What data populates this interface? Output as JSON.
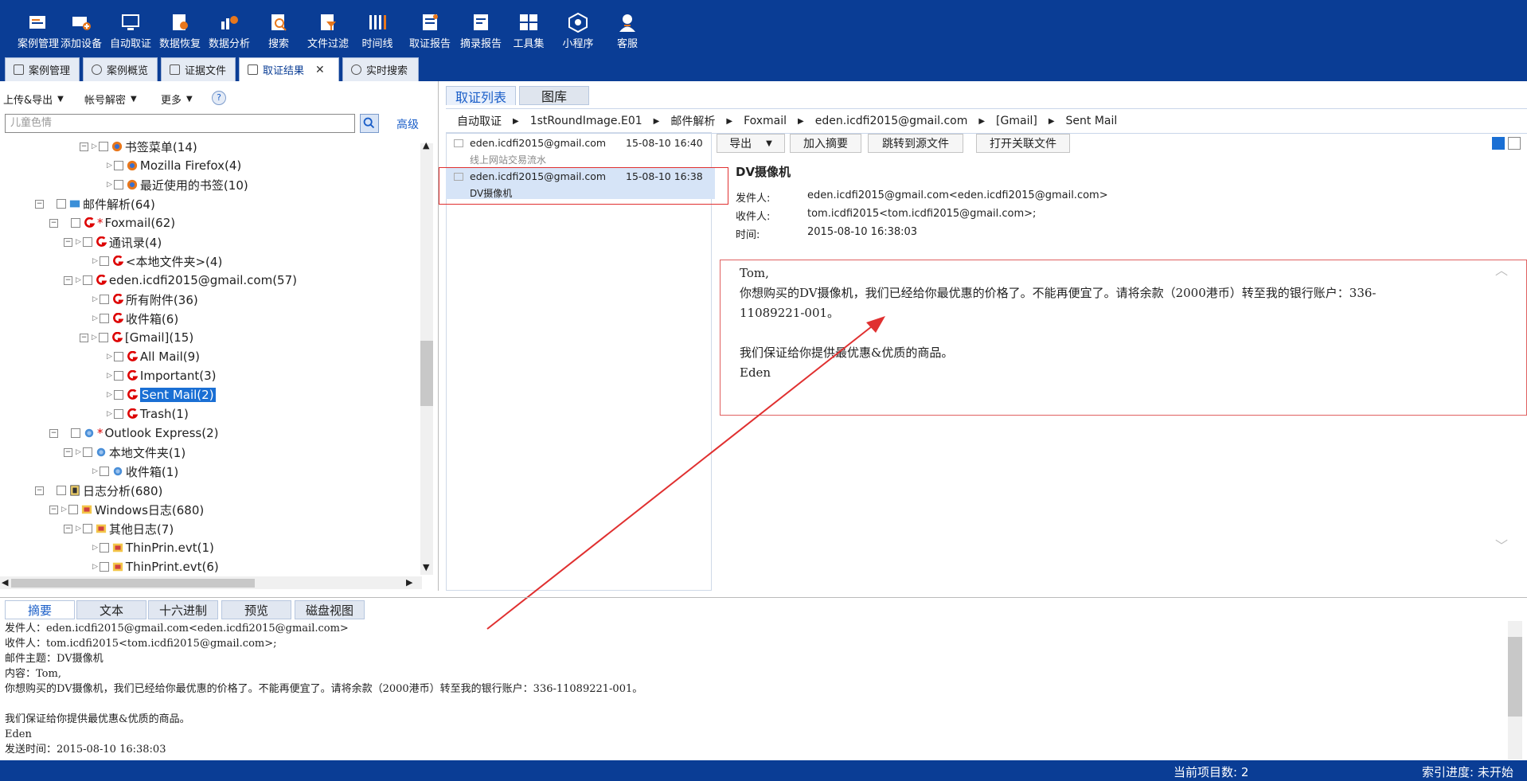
{
  "toolbar": {
    "items": [
      {
        "label": "案例管理",
        "icon": "case-icon"
      },
      {
        "label": "添加设备",
        "icon": "add-device-icon"
      },
      {
        "label": "自动取证",
        "icon": "auto-icon"
      },
      {
        "label": "数据恢复",
        "icon": "recover-icon"
      },
      {
        "label": "数据分析",
        "icon": "analysis-icon"
      },
      {
        "label": "搜索",
        "icon": "search-icon"
      },
      {
        "label": "文件过滤",
        "icon": "filter-icon"
      },
      {
        "label": "时间线",
        "icon": "timeline-icon"
      },
      {
        "label": "取证报告",
        "icon": "report-icon"
      },
      {
        "label": "摘录报告",
        "icon": "excerpt-icon"
      },
      {
        "label": "工具集",
        "icon": "tools-icon"
      },
      {
        "label": "小程序",
        "icon": "miniapp-icon"
      },
      {
        "label": "客服",
        "icon": "support-icon"
      }
    ]
  },
  "tabs": [
    {
      "label": "案例管理"
    },
    {
      "label": "案例概览"
    },
    {
      "label": "证据文件"
    },
    {
      "label": "取证结果"
    },
    {
      "label": "实时搜索"
    }
  ],
  "left": {
    "dropdowns": [
      "上传&导出",
      "帐号解密",
      "更多"
    ],
    "help": "?",
    "search_placeholder": "儿童色情",
    "advanced": "高级",
    "tree": [
      "书签菜单(14)",
      "Mozilla Firefox(4)",
      "最近使用的书签(10)",
      "邮件解析(64)",
      "Foxmail(62)",
      "通讯录(4)",
      "<本地文件夹>(4)",
      "eden.icdfi2015@gmail.com(57)",
      "所有附件(36)",
      "收件箱(6)",
      "[Gmail](15)",
      "All Mail(9)",
      "Important(3)",
      "Sent Mail(2)",
      "Trash(1)",
      "Outlook Express(2)",
      "本地文件夹(1)",
      "收件箱(1)",
      "日志分析(680)",
      "Windows日志(680)",
      "其他日志(7)",
      "ThinPrin.evt(1)",
      "ThinPrint.evt(6)"
    ]
  },
  "right": {
    "tabs": [
      "取证列表",
      "图库"
    ],
    "breadcrumb": [
      "自动取证",
      "1stRoundImage.E01",
      "邮件解析",
      "Foxmail",
      "eden.icdfi2015@gmail.com",
      "[Gmail]",
      "Sent Mail"
    ],
    "mails": [
      {
        "from": "eden.icdfi2015@gmail.com",
        "date": "15-08-10 16:40",
        "subject": "线上网站交易流水"
      },
      {
        "from": "eden.icdfi2015@gmail.com",
        "date": "15-08-10 16:38",
        "subject": "DV摄像机"
      }
    ],
    "buttons": [
      "导出",
      "加入摘要",
      "跳转到源文件",
      "打开关联文件"
    ],
    "detail": {
      "subject": "DV摄像机",
      "from_label": "发件人:",
      "from": "eden.icdfi2015@gmail.com<eden.icdfi2015@gmail.com>",
      "to_label": "收件人:",
      "to": "tom.icdfi2015<tom.icdfi2015@gmail.com>;",
      "time_label": "时间:",
      "time": "2015-08-10 16:38:03",
      "body": [
        "Tom,",
        "你想购买的DV摄像机，我们已经给你最优惠的价格了。不能再便宜了。请将余款（2000港币）转至我的银行账户：336-",
        "11089221-001。",
        "",
        "我们保证给你提供最优惠&优质的商品。",
        "Eden"
      ]
    }
  },
  "bottom": {
    "tabs": [
      "摘要",
      "文本",
      "十六进制",
      "预览",
      "磁盘视图"
    ],
    "summary": [
      "发件人：eden.icdfi2015@gmail.com<eden.icdfi2015@gmail.com>",
      "收件人：tom.icdfi2015<tom.icdfi2015@gmail.com>;",
      "邮件主题：DV摄像机",
      "内容：Tom,",
      "你想购买的DV摄像机，我们已经给你最优惠的价格了。不能再便宜了。请将余款（2000港币）转至我的银行账户：336-11089221-001。",
      "",
      "我们保证给你提供最优惠&优质的商品。",
      "Eden",
      "发送时间：2015-08-10 16:38:03"
    ]
  },
  "status": {
    "count": "当前项目数: 2",
    "index": "索引进度: 未开始"
  },
  "colors": {
    "brand": "#0a3d95",
    "accent": "#1a6fd4",
    "annotation": "#e03030"
  }
}
